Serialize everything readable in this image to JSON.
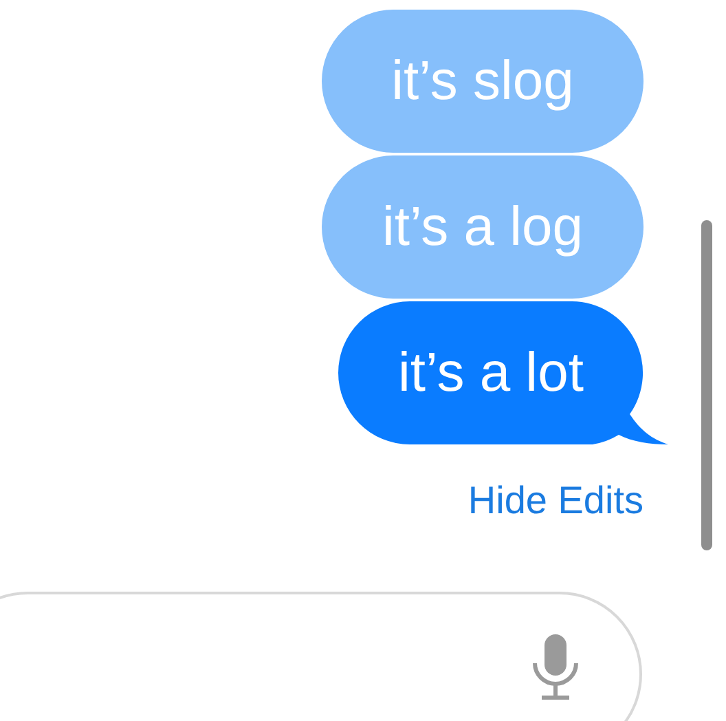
{
  "messages": [
    {
      "text": "it’s slog",
      "kind": "edit"
    },
    {
      "text": "it’s a log",
      "kind": "edit"
    },
    {
      "text": "it’s a lot",
      "kind": "final"
    }
  ],
  "hide_edits_link": "Hide Edits"
}
